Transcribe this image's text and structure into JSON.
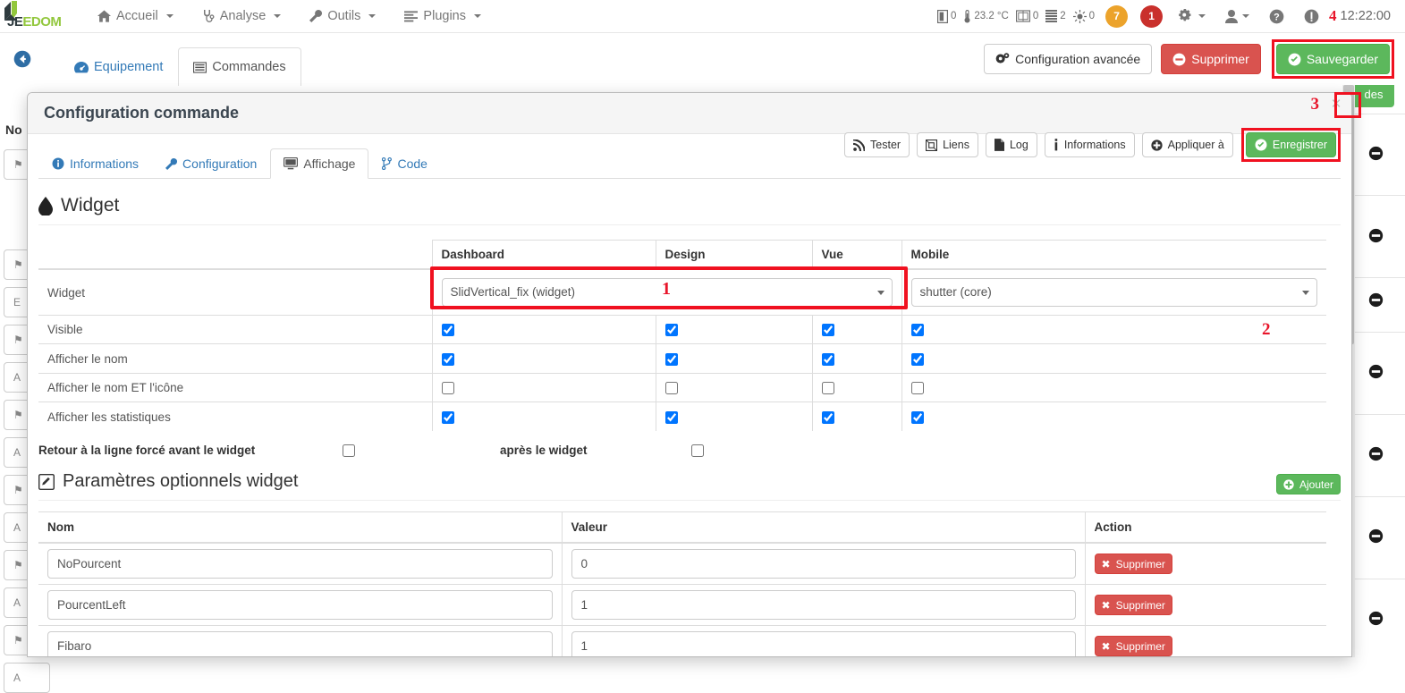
{
  "navbar": {
    "brand": {
      "dark": "JE",
      "green": "EDOM"
    },
    "items": [
      {
        "label": "Accueil",
        "icon": "home-icon",
        "caret": true
      },
      {
        "label": "Analyse",
        "icon": "stethoscope-icon",
        "caret": true
      },
      {
        "label": "Outils",
        "icon": "wrench-icon",
        "caret": true
      },
      {
        "label": "Plugins",
        "icon": "list-icon",
        "caret": false
      }
    ],
    "stats": [
      {
        "icon": "door-icon",
        "value": "0"
      },
      {
        "icon": "thermometer-icon",
        "value": "23.2 °C"
      },
      {
        "icon": "window-icon",
        "value": "0"
      },
      {
        "icon": "shutter-icon",
        "value": "2"
      },
      {
        "icon": "light-icon",
        "value": "0"
      }
    ],
    "badges": [
      {
        "name": "warning-badge",
        "value": "7",
        "color": "#eca32b"
      },
      {
        "name": "error-badge",
        "value": "1",
        "color": "#c9302c"
      }
    ],
    "icon_buttons": [
      {
        "name": "gear-icon",
        "caret": true
      },
      {
        "name": "user-icon",
        "caret": true
      },
      {
        "name": "help-icon",
        "caret": false
      },
      {
        "name": "info-icon",
        "caret": false
      }
    ],
    "marker": "4",
    "clock": "12:22:00"
  },
  "subbar": {
    "back_icon": "back-arrow-icon",
    "tabs": [
      {
        "label": "Equipement",
        "icon": "dashboard-icon",
        "active": false
      },
      {
        "label": "Commandes",
        "icon": "table-icon",
        "active": true
      }
    ],
    "buttons": [
      {
        "name": "advanced-config-button",
        "label": "Configuration avancée",
        "icon": "gears-icon",
        "style": "default"
      },
      {
        "name": "delete-button",
        "label": "Supprimer",
        "icon": "minus-circle-icon",
        "style": "danger"
      },
      {
        "name": "save-button",
        "label": "Sauvegarder",
        "icon": "check-circle-icon",
        "style": "success",
        "highlighted": true
      }
    ]
  },
  "background": {
    "left_column_header": "No",
    "right_tab_label": "des"
  },
  "modal": {
    "title": "Configuration commande",
    "close_label": "×",
    "marker_close": "3",
    "tabs": [
      {
        "label": "Informations",
        "icon": "info-circle-icon",
        "active": false
      },
      {
        "label": "Configuration",
        "icon": "wrench-icon",
        "active": false
      },
      {
        "label": "Affichage",
        "icon": "desktop-icon",
        "active": true
      },
      {
        "label": "Code",
        "icon": "code-branch-icon",
        "active": false
      }
    ],
    "tools": [
      {
        "name": "test-button",
        "label": "Tester",
        "icon": "rss-icon",
        "style": "default"
      },
      {
        "name": "links-button",
        "label": "Liens",
        "icon": "sitemap-icon",
        "style": "default"
      },
      {
        "name": "log-button",
        "label": "Log",
        "icon": "file-icon",
        "style": "default"
      },
      {
        "name": "informations-button",
        "label": "Informations",
        "icon": "info-icon",
        "style": "default"
      },
      {
        "name": "apply-to-button",
        "label": "Appliquer à",
        "icon": "plus-circle-icon",
        "style": "default"
      },
      {
        "name": "register-button",
        "label": "Enregistrer",
        "icon": "check-circle-icon",
        "style": "success",
        "highlighted": true
      }
    ],
    "marker_register": "2",
    "widget_section": {
      "title": "Widget",
      "icon": "droplet-icon",
      "columns": [
        "",
        "Dashboard",
        "Design",
        "Vue",
        "Mobile"
      ],
      "widget_row_label": "Widget",
      "dashboard_select": "SlidVertical_fix (widget)",
      "mobile_select": "shutter (core)",
      "marker_select": "1",
      "rows": [
        {
          "label": "Visible",
          "dashboard": true,
          "design": true,
          "vue": true,
          "mobile": true
        },
        {
          "label": "Afficher le nom",
          "dashboard": true,
          "design": true,
          "vue": true,
          "mobile": true
        },
        {
          "label": "Afficher le nom ET l'icône",
          "dashboard": false,
          "design": false,
          "vue": false,
          "mobile": false
        },
        {
          "label": "Afficher les statistiques",
          "dashboard": true,
          "design": true,
          "vue": true,
          "mobile": true
        }
      ],
      "linebreak_before_label": "Retour à la ligne forcé avant le widget",
      "linebreak_before_checked": false,
      "linebreak_after_label": "après le widget",
      "linebreak_after_checked": false
    },
    "params_section": {
      "title": "Paramètres optionnels widget",
      "icon": "edit-icon",
      "add_button": {
        "name": "add-param-button",
        "label": "Ajouter",
        "icon": "plus-circle-icon"
      },
      "columns": [
        "Nom",
        "Valeur",
        "Action"
      ],
      "rows": [
        {
          "name": "NoPourcent",
          "value": "0",
          "action_label": "Supprimer",
          "action_icon": "times-icon"
        },
        {
          "name": "PourcentLeft",
          "value": "1",
          "action_label": "Supprimer",
          "action_icon": "times-icon"
        },
        {
          "name": "Fibaro",
          "value": "1",
          "action_label": "Supprimer",
          "action_icon": "times-icon"
        }
      ]
    }
  },
  "colors": {
    "accent_red": "#f01120",
    "success_green": "#5cb85c",
    "danger_red": "#d9534f",
    "link_blue": "#337ab7"
  }
}
